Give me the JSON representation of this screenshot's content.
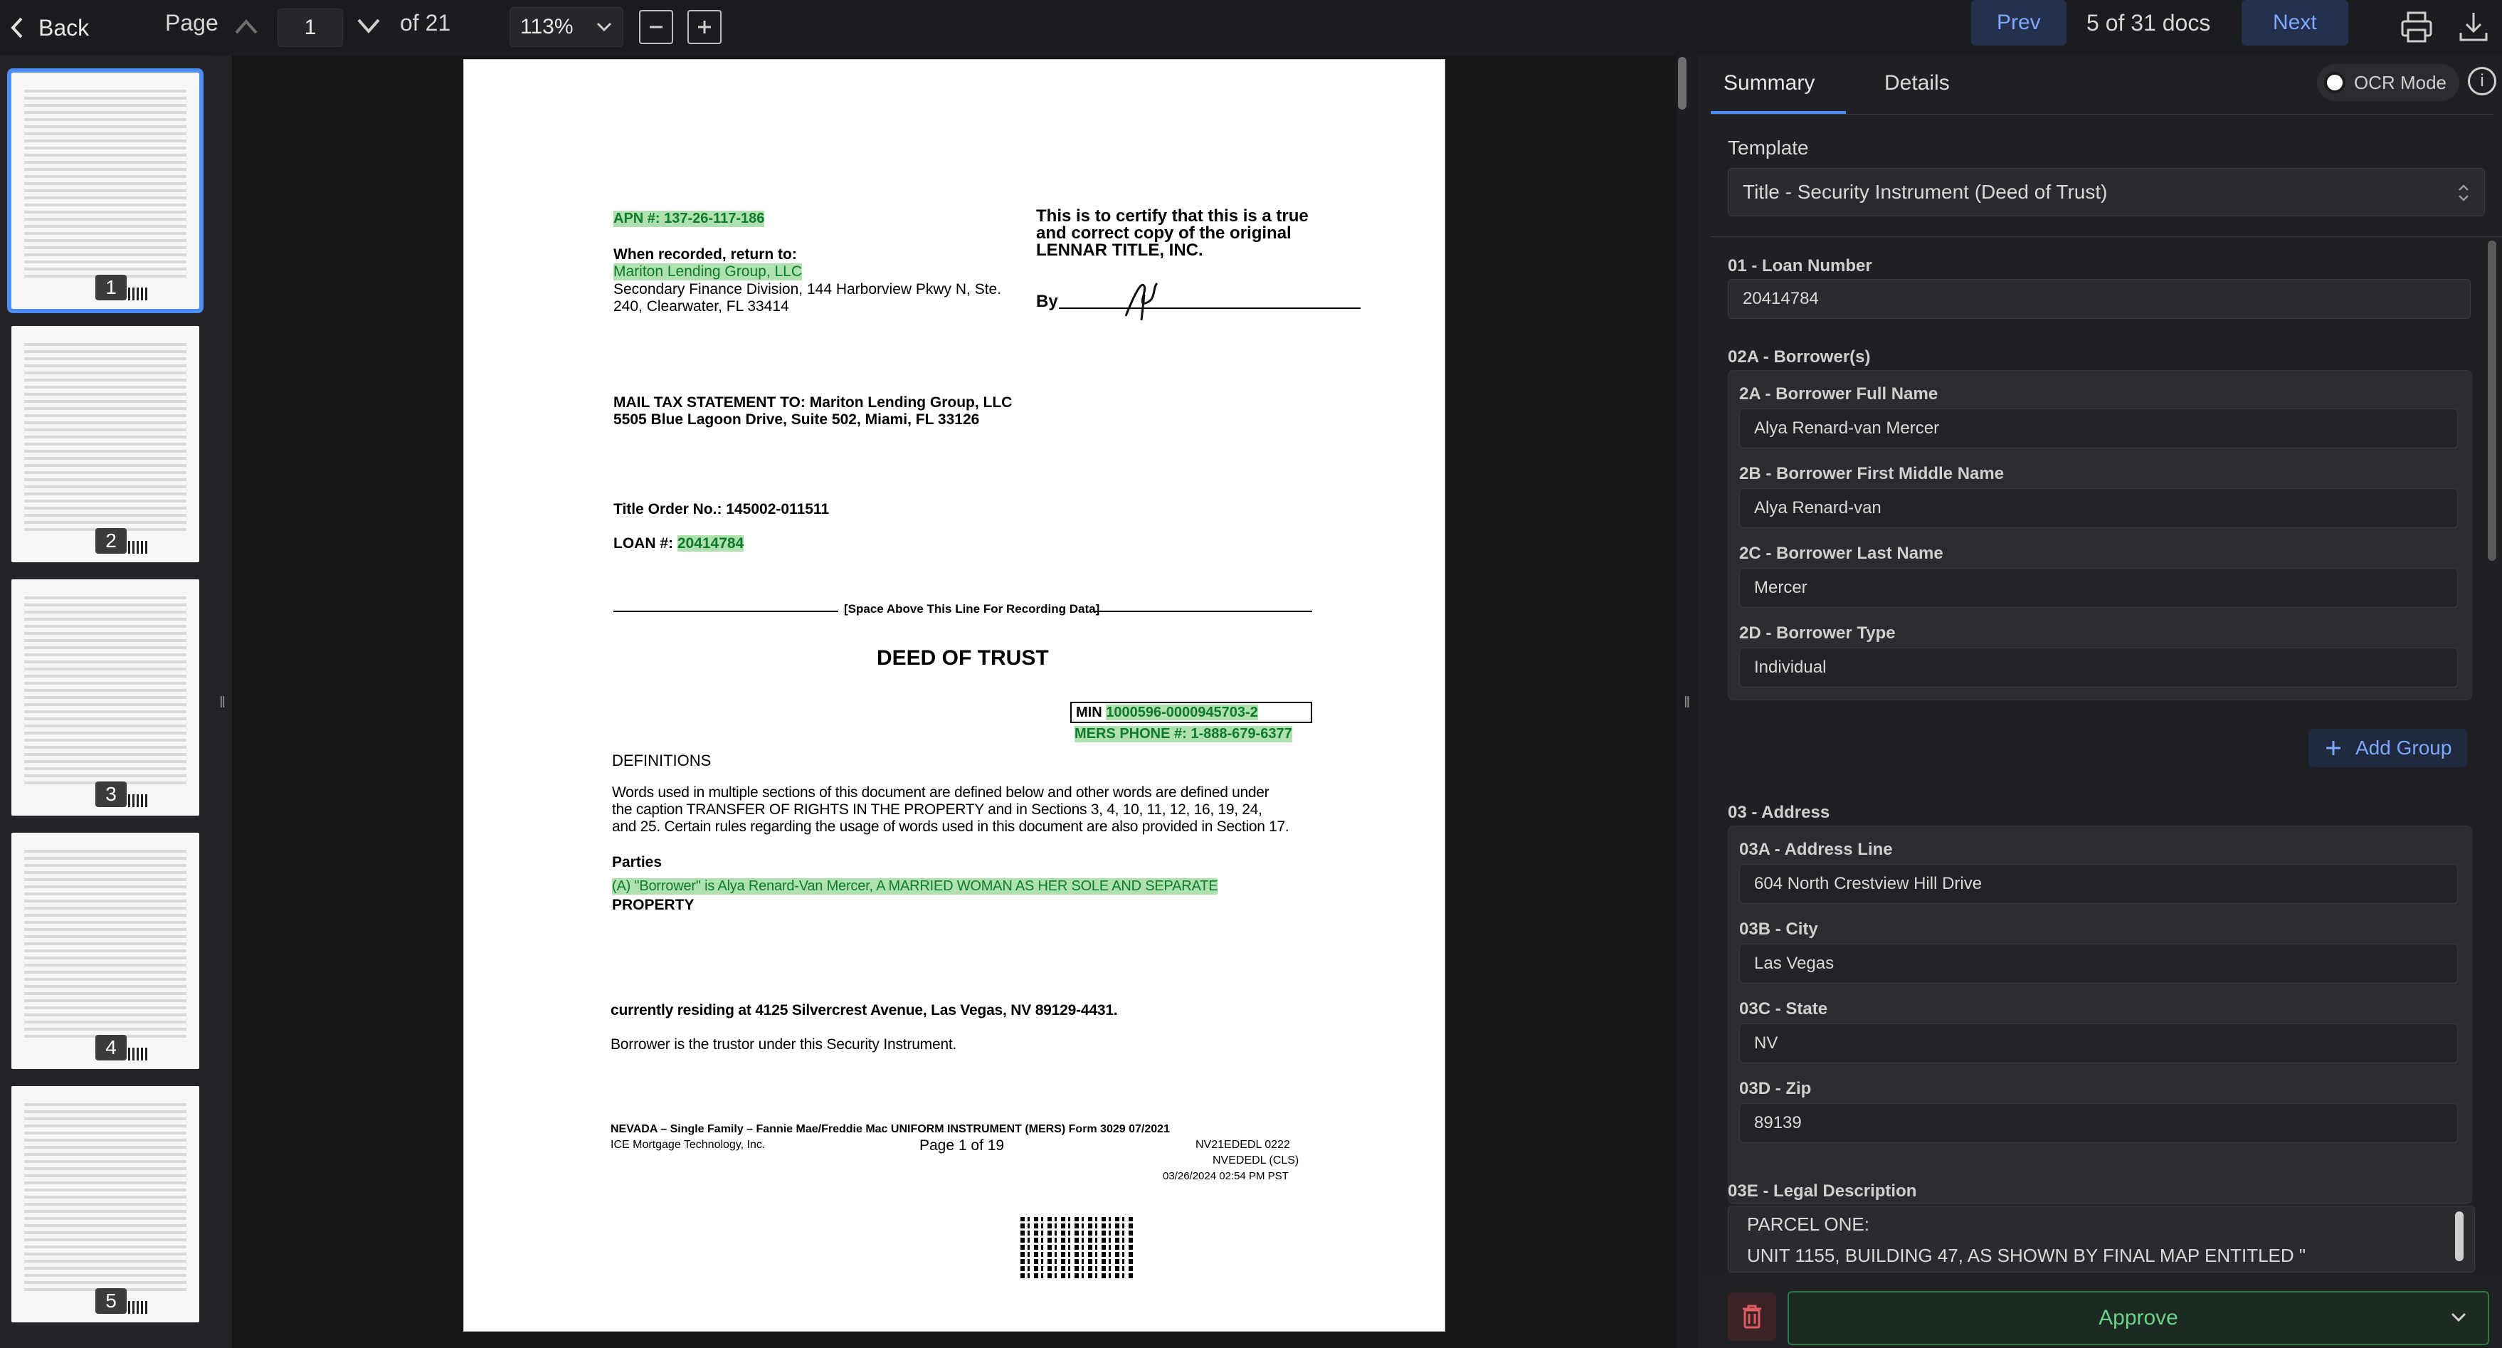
{
  "topbar": {
    "back_label": "Back",
    "page_label": "Page",
    "page_value": "1",
    "page_of": "of 21",
    "zoom": "113%",
    "prev_label": "Prev",
    "doc_count": "5 of 31 docs",
    "next_label": "Next"
  },
  "thumbnails": [
    {
      "number": "1"
    },
    {
      "number": "2"
    },
    {
      "number": "3"
    },
    {
      "number": "4"
    },
    {
      "number": "5"
    }
  ],
  "document": {
    "apn": "APN #: 137-26-117-186",
    "recorded_return": "When recorded, return to:",
    "lender_name": "Mariton Lending Group, LLC",
    "lender_address_1": "Secondary Finance Division, 144 Harborview Pkwy N, Ste.",
    "lender_address_2": "240, Clearwater, FL 33414",
    "certify_1": "This is to certify that this is a true",
    "certify_2": "and correct copy of the original",
    "certify_3": "LENNAR TITLE, INC.",
    "by": "By",
    "mail_tax_1": "MAIL TAX STATEMENT TO:   Mariton Lending Group, LLC",
    "mail_tax_2": "5505 Blue Lagoon Drive, Suite 502, Miami, FL 33126",
    "title_order": "Title Order No.:  145002-011511",
    "loan_prefix": "LOAN #:",
    "loan_number": "20414784",
    "space_above": "[Space Above This Line For Recording Data]",
    "deed_title": "DEED OF TRUST",
    "min_prefix": "MIN",
    "min_number": "1000596-0000945703-2",
    "mers_phone": "MERS PHONE #: 1-888-679-6377",
    "definitions": "DEFINITIONS",
    "def_text_1": "Words used in multiple sections of this document are defined below and other words are defined under",
    "def_text_2": "the caption TRANSFER OF RIGHTS IN THE PROPERTY and in Sections 3, 4, 10, 11, 12, 16, 19, 24,",
    "def_text_3": "and 25. Certain rules regarding the usage of words used in this document are also provided in Section 17.",
    "parties": "Parties",
    "borrower_line": "(A) \"Borrower\" is  Alya Renard-Van Mercer, A MARRIED WOMAN AS HER SOLE AND SEPARATE",
    "property": "PROPERTY",
    "residing": "currently residing at 4125 Silvercrest Avenue, Las Vegas, NV 89129-4431.",
    "trustor": "Borrower is the trustor under this Security Instrument.",
    "footer_1": "NEVADA – Single Family – Fannie Mae/Freddie Mac UNIFORM INSTRUMENT   (MERS)   Form 3029   07/2021",
    "footer_2": "ICE Mortgage Technology, Inc.",
    "footer_page": "Page 1 of 19",
    "footer_code_1": "NV21EDEDL   0222",
    "footer_code_2": "NVEDEDL (CLS)",
    "footer_date": "03/26/2024 02:54 PM PST"
  },
  "panel": {
    "tab_summary": "Summary",
    "tab_details": "Details",
    "ocr_label": "OCR Mode",
    "template_label": "Template",
    "template_value": "Title - Security Instrument (Deed of Trust)",
    "loan_number_label": "01 - Loan Number",
    "loan_number_value": "20414784",
    "borrowers_label": "02A - Borrower(s)",
    "borrower_full_label": "2A - Borrower Full Name",
    "borrower_full_value": "Alya Renard-van Mercer",
    "borrower_first_label": "2B - Borrower First Middle Name",
    "borrower_first_value": "Alya Renard-van",
    "borrower_last_label": "2C - Borrower Last Name",
    "borrower_last_value": "Mercer",
    "borrower_type_label": "2D - Borrower Type",
    "borrower_type_value": "Individual",
    "add_group_label": "Add Group",
    "address_label": "03 - Address",
    "address_line_label": "03A - Address Line",
    "address_line_value": "604 North Crestview Hill Drive",
    "city_label": "03B - City",
    "city_value": "Las Vegas",
    "state_label": "03C - State",
    "state_value": "NV",
    "zip_label": "03D - Zip",
    "zip_value": "89139",
    "legal_label": "03E - Legal Description",
    "legal_line_1": "PARCEL ONE:",
    "legal_line_2": "UNIT 1155, BUILDING 47, AS SHOWN BY FINAL MAP ENTITLED \"",
    "approve_label": "Approve"
  },
  "colors": {
    "accent": "#4d8ef6",
    "highlight": "#6dc96e",
    "approve_green": "#69d28b"
  }
}
